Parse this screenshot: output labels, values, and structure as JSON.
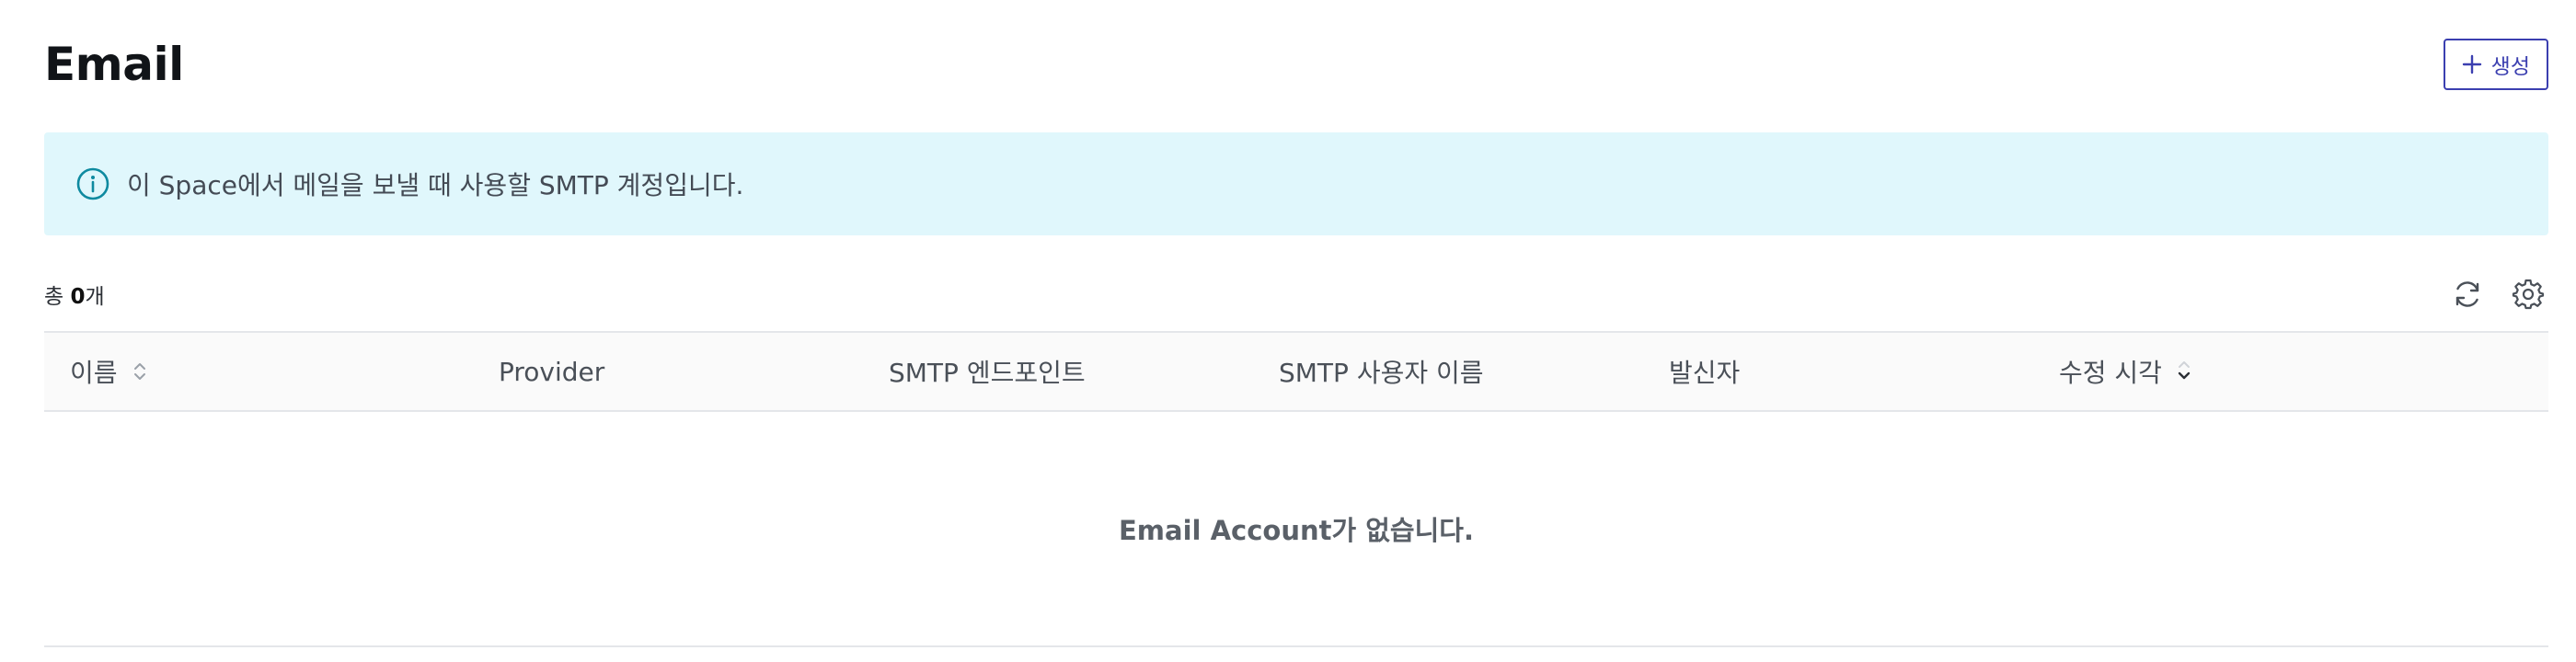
{
  "page": {
    "title": "Email",
    "create_button_label": "생성"
  },
  "banner": {
    "text": "이 Space에서 메일을 보낼 때 사용할 SMTP 계정입니다.",
    "icon": "info-icon",
    "color": "#e0f7fc"
  },
  "summary": {
    "prefix": "총 ",
    "count": "0",
    "suffix": "개"
  },
  "toolbar": {
    "icons": [
      "refresh-icon",
      "gear-icon"
    ]
  },
  "table": {
    "columns": [
      {
        "label": "이름",
        "sortable": true
      },
      {
        "label": "Provider",
        "sortable": false
      },
      {
        "label": "SMTP 엔드포인트",
        "sortable": false
      },
      {
        "label": "SMTP 사용자 이름",
        "sortable": false
      },
      {
        "label": "발신자",
        "sortable": false
      },
      {
        "label": "수정 시각",
        "sortable": true,
        "sort_direction": "desc"
      }
    ],
    "empty_message": "Email Account가 없습니다."
  },
  "colors": {
    "accent": "#3b3fb0",
    "info": "#0e8aa0"
  }
}
